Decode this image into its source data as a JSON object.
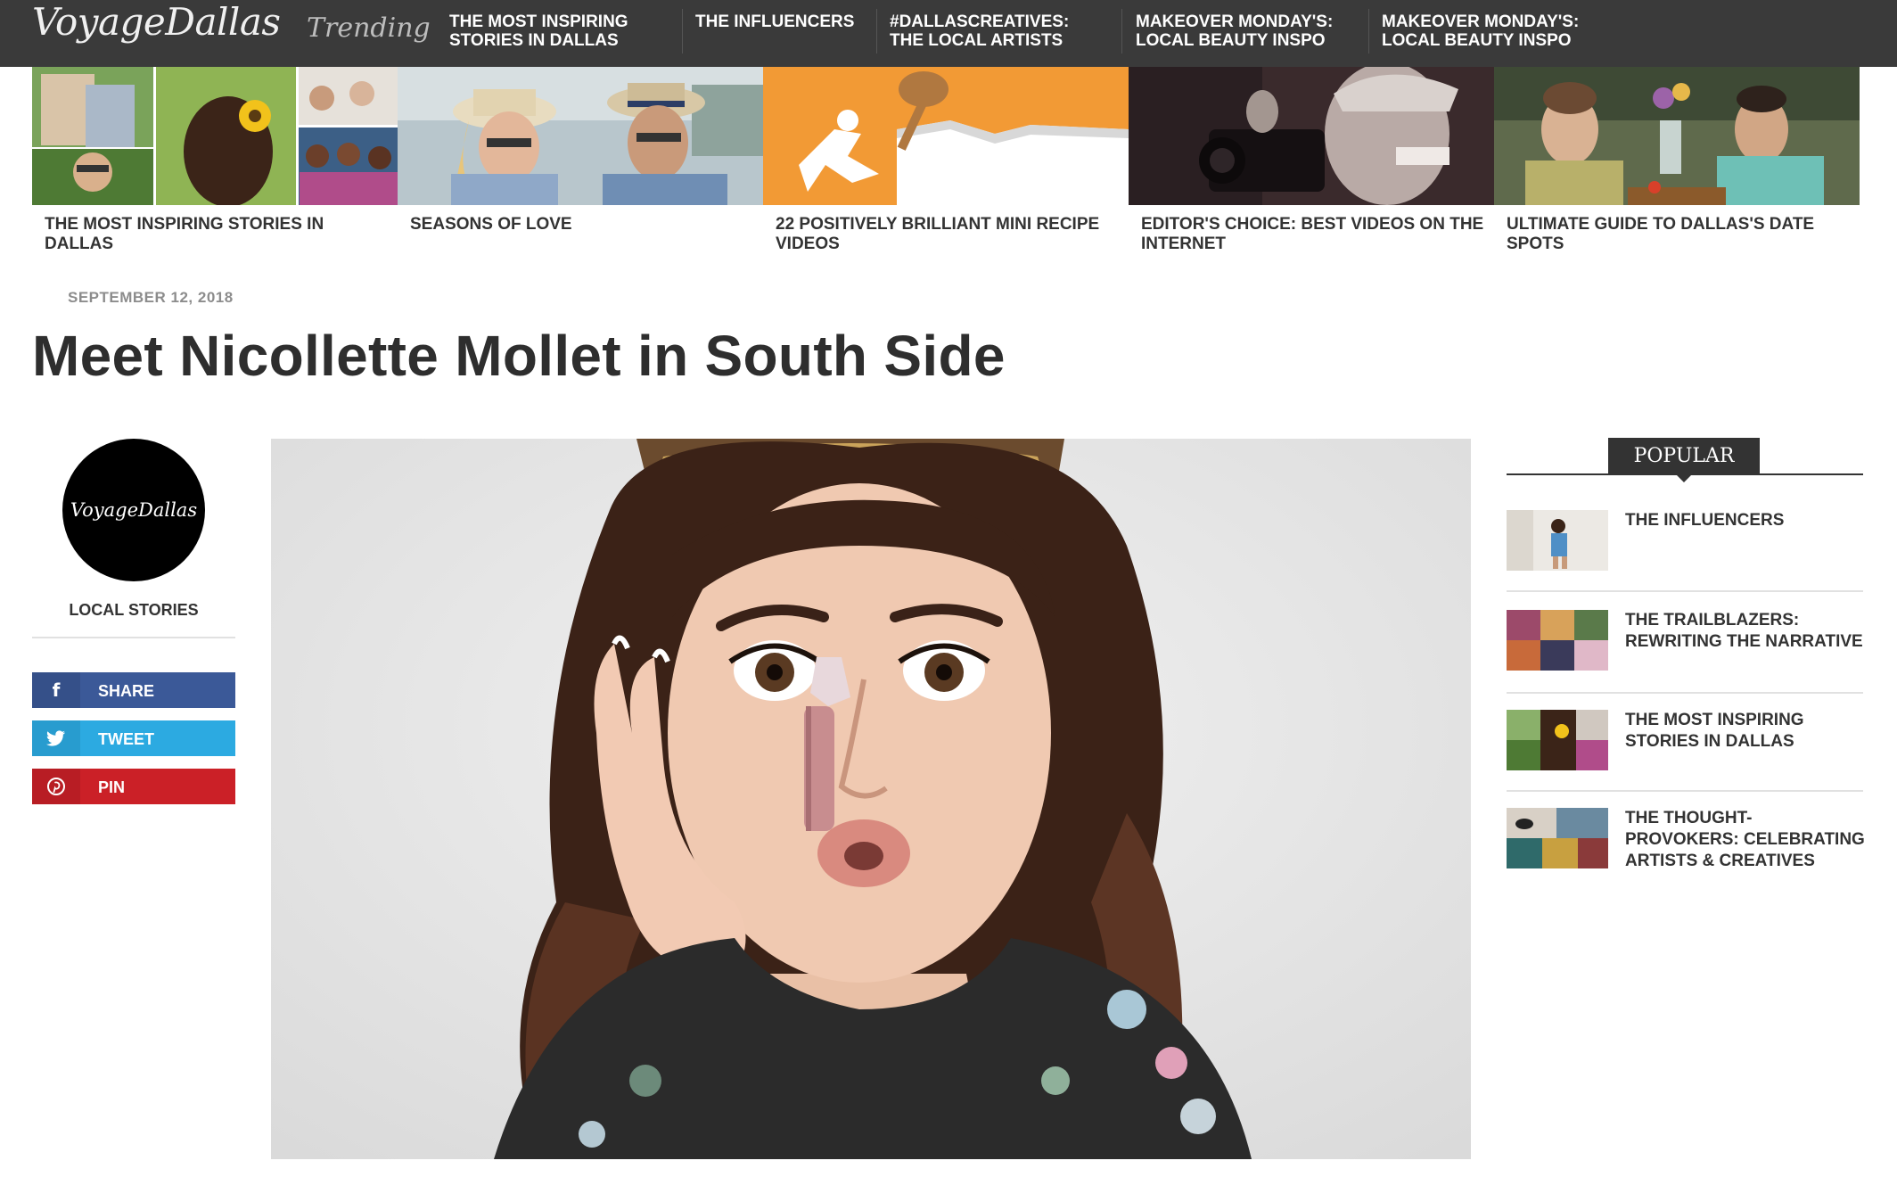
{
  "header": {
    "logo": "VoyageDallas",
    "trending_label": "Trending",
    "links": [
      "THE MOST INSPIRING STORIES IN DALLAS",
      "THE INFLUENCERS",
      "#DALLASCREATIVES: THE LOCAL ARTISTS",
      "MAKEOVER MONDAY'S: LOCAL BEAUTY INSPO",
      "MAKEOVER MONDAY'S: LOCAL BEAUTY INSPO"
    ]
  },
  "trending_strip": [
    {
      "title": "THE MOST INSPIRING STORIES IN DALLAS"
    },
    {
      "title": "SEASONS OF LOVE"
    },
    {
      "title": "22 POSITIVELY BRILLIANT MINI RECIPE VIDEOS"
    },
    {
      "title": "EDITOR'S CHOICE: BEST VIDEOS ON THE INTERNET"
    },
    {
      "title": "ULTIMATE GUIDE TO DALLAS'S DATE SPOTS"
    }
  ],
  "article": {
    "date": "SEPTEMBER 12, 2018",
    "title": "Meet Nicollette Mollet in South Side"
  },
  "author": {
    "avatar_text": "VoyageDallas",
    "label": "LOCAL STORIES"
  },
  "share": {
    "share_label": "SHARE",
    "tweet_label": "TWEET",
    "pin_label": "PIN",
    "facebook_color": "#3b5998",
    "twitter_color": "#2caae1",
    "pinterest_color": "#cb2027"
  },
  "sidebar": {
    "heading": "POPULAR",
    "items": [
      {
        "title": "THE INFLUENCERS"
      },
      {
        "title": "THE TRAILBLAZERS: REWRITING THE NARRATIVE"
      },
      {
        "title": "THE MOST INSPIRING STORIES IN DALLAS"
      },
      {
        "title": "THE THOUGHT-PROVOKERS: CELEBRATING ARTISTS & CREATIVES"
      }
    ]
  },
  "icons": {
    "facebook": "facebook-icon",
    "twitter": "twitter-icon",
    "pinterest": "pinterest-icon"
  }
}
